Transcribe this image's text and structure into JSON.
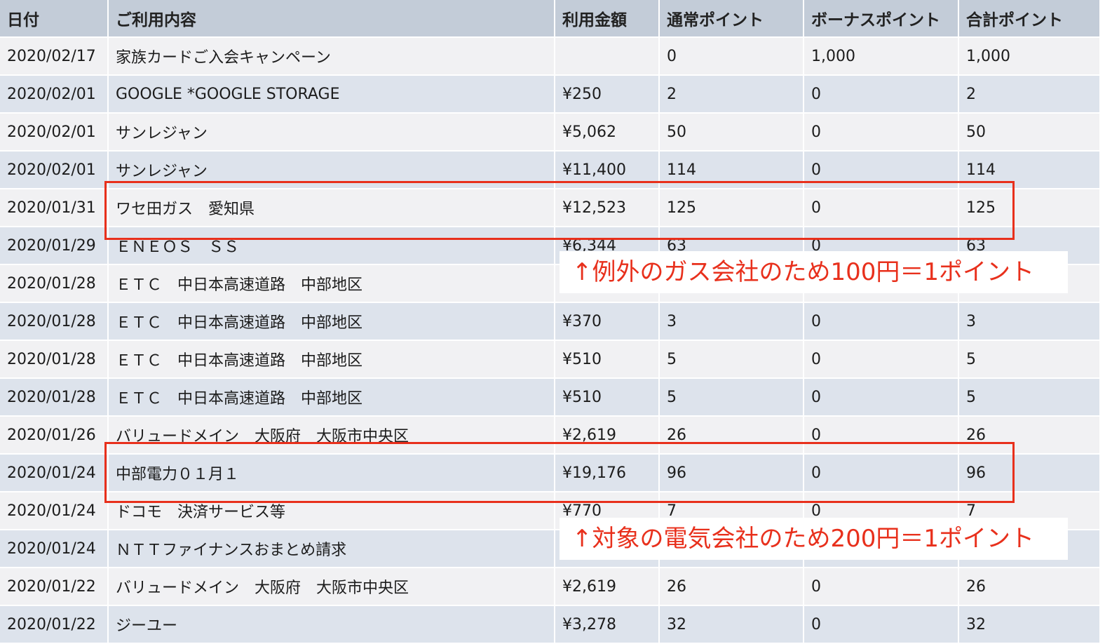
{
  "table": {
    "headers": [
      "日付",
      "ご利用内容",
      "利用金額",
      "通常ポイント",
      "ボーナスポイント",
      "合計ポイント"
    ],
    "rows": [
      [
        "2020/02/17",
        "家族カードご入会キャンペーン",
        "",
        "0",
        "1,000",
        "1,000"
      ],
      [
        "2020/02/01",
        "GOOGLE *GOOGLE STORAGE",
        "¥250",
        "2",
        "0",
        "2"
      ],
      [
        "2020/02/01",
        "サンレジャン",
        "¥5,062",
        "50",
        "0",
        "50"
      ],
      [
        "2020/02/01",
        "サンレジャン",
        "¥11,400",
        "114",
        "0",
        "114"
      ],
      [
        "2020/01/31",
        "ワセ田ガス　愛知県",
        "¥12,523",
        "125",
        "0",
        "125"
      ],
      [
        "2020/01/29",
        "ＥＮＥＯＳ　ＳＳ",
        "¥6,344",
        "63",
        "0",
        "63"
      ],
      [
        "2020/01/28",
        "ＥＴＣ　中日本高速道路　中部地区",
        "",
        "",
        "",
        ""
      ],
      [
        "2020/01/28",
        "ＥＴＣ　中日本高速道路　中部地区",
        "¥370",
        "3",
        "0",
        "3"
      ],
      [
        "2020/01/28",
        "ＥＴＣ　中日本高速道路　中部地区",
        "¥510",
        "5",
        "0",
        "5"
      ],
      [
        "2020/01/28",
        "ＥＴＣ　中日本高速道路　中部地区",
        "¥510",
        "5",
        "0",
        "5"
      ],
      [
        "2020/01/26",
        "バリュードメイン　大阪府　大阪市中央区",
        "¥2,619",
        "26",
        "0",
        "26"
      ],
      [
        "2020/01/24",
        "中部電力０１月１",
        "¥19,176",
        "96",
        "0",
        "96"
      ],
      [
        "2020/01/24",
        "ドコモ　決済サービス等",
        "¥770",
        "7",
        "0",
        "7"
      ],
      [
        "2020/01/24",
        "ＮＴＴファイナンスおまとめ請求",
        "",
        "",
        "",
        ""
      ],
      [
        "2020/01/22",
        "バリュードメイン　大阪府　大阪市中央区",
        "¥2,619",
        "26",
        "0",
        "26"
      ],
      [
        "2020/01/22",
        "ジーユー",
        "¥3,278",
        "32",
        "0",
        "32"
      ]
    ]
  },
  "annotations": {
    "note1": "↑例外のガス会社のため100円＝1ポイント",
    "note2": "↑対象の電気会社のため200円＝1ポイント",
    "color": "#e8301c"
  }
}
